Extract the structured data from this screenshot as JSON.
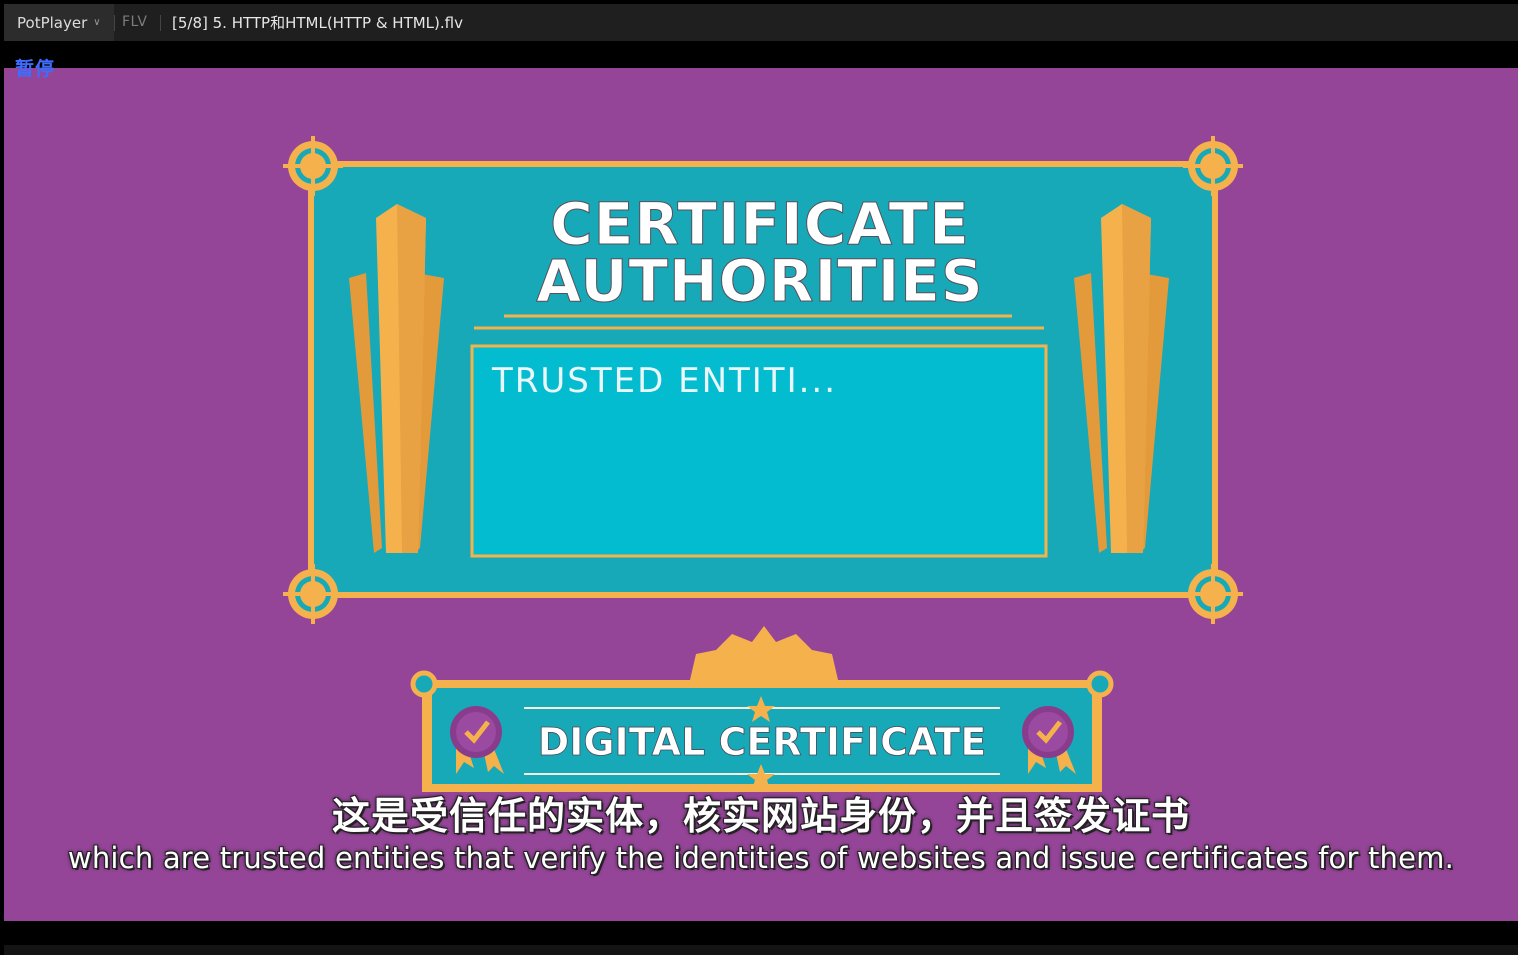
{
  "titlebar": {
    "app_name": "PotPlayer",
    "format": "FLV",
    "filename": "[5/8] 5. HTTP和HTML(HTTP & HTML).flv"
  },
  "player": {
    "status": "暂停"
  },
  "video_frame": {
    "certificate": {
      "title_line1": "CERTIFICATE",
      "title_line2": "AUTHORITIES",
      "typed_text": "TRUSTED ENTITI..."
    },
    "badge": {
      "label": "DIGITAL CERTIFICATE"
    }
  },
  "subtitles": {
    "chinese": "这是受信任的实体，核实网站身份，并且签发证书",
    "english": "which are trusted entities that verify the identities of websites and issue certificates for them."
  },
  "colors": {
    "background_purple": "#944597",
    "teal": "#17a9b8",
    "gold": "#f5b24c",
    "inner_box": "#04bccf"
  }
}
